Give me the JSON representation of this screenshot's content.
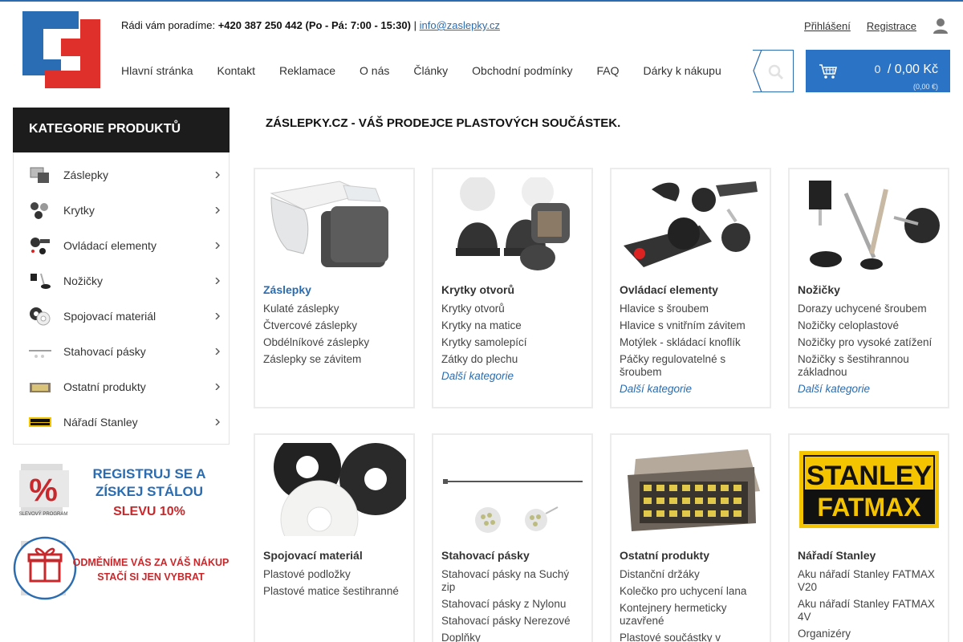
{
  "header": {
    "contact_prefix": "Rádi vám poradíme:",
    "phone": "+420 387 250 442 (Po - Pá: 7:00 - 15:30)",
    "separator": "|",
    "email": "info@zaslepky.cz",
    "login": "Přihlášení",
    "register": "Registrace"
  },
  "nav": [
    "Hlavní stránka",
    "Kontakt",
    "Reklamace",
    "O nás",
    "Články",
    "Obchodní podmínky",
    "FAQ",
    "Dárky k nákupu"
  ],
  "cart": {
    "count": "0",
    "slash": "/",
    "total": "0,00 Kč",
    "total_eur": "(0,00 €)"
  },
  "sidebar": {
    "title": "KATEGORIE PRODUKTŮ",
    "items": [
      "Záslepky",
      "Krytky",
      "Ovládací elementy",
      "Nožičky",
      "Spojovací materiál",
      "Stahovací pásky",
      "Ostatní produkty",
      "Nářadí Stanley"
    ]
  },
  "banners": {
    "banner1_line1": "REGISTRUJ SE A",
    "banner1_line2": "ZÍSKEJ STÁLOU",
    "banner1_line3": "SLEVU 10%",
    "banner1_badge": "SLEVOVÝ PROGRAM",
    "banner2_line1": "ODMĚNÍME VÁS ZA VÁŠ NÁKUP",
    "banner2_line2": "STAČÍ SI JEN VYBRAT"
  },
  "main": {
    "title": "ZÁSLEPKY.CZ - VÁŠ PRODEJCE PLASTOVÝCH SOUČÁSTEK.",
    "more_label": "Další kategorie",
    "cards": [
      {
        "title": "Záslepky",
        "links": [
          "Kulaté záslepky",
          "Čtvercové záslepky",
          "Obdélníkové záslepky",
          "Záslepky se závitem"
        ],
        "more": false
      },
      {
        "title": "Krytky otvorů",
        "links": [
          "Krytky otvorů",
          "Krytky na matice",
          "Krytky samolepící",
          "Zátky do plechu"
        ],
        "more": true
      },
      {
        "title": "Ovládací elementy",
        "links": [
          "Hlavice s šroubem",
          "Hlavice s vnitřním závitem",
          "Motýlek - skládací knoflík",
          "Páčky regulovatelné s šroubem"
        ],
        "more": true
      },
      {
        "title": "Nožičky",
        "links": [
          "Dorazy uchycené šroubem",
          "Nožičky celoplastové",
          "Nožičky pro vysoké zatížení",
          "Nožičky s šestihrannou základnou"
        ],
        "more": true
      },
      {
        "title": "Spojovací materiál",
        "links": [
          "Plastové podložky",
          "Plastové matice šestihranné"
        ],
        "more": false
      },
      {
        "title": "Stahovací pásky",
        "links": [
          "Stahovací pásky na Suchý zip",
          "Stahovací pásky z Nylonu",
          "Stahovací pásky Nerezové",
          "Doplňky"
        ],
        "more": false
      },
      {
        "title": "Ostatní produkty",
        "links": [
          "Distanční držáky",
          "Kolečko pro uchycení lana",
          "Kontejnery hermeticky uzavřené",
          "Plastové součástky v"
        ],
        "more": false
      },
      {
        "title": "Nářadí Stanley",
        "links": [
          "Aku nářadí Stanley FATMAX V20",
          "Aku nářadí Stanley FATMAX 4V",
          "Organizéry"
        ],
        "more": false
      }
    ],
    "stanley_logo_line1": "STANLEY",
    "stanley_logo_line2": "FATMAX"
  },
  "colors": {
    "accent": "#2b6cb0",
    "cart": "#2b73c4",
    "logo_blue": "#2a6db5",
    "logo_red": "#e0302b"
  }
}
